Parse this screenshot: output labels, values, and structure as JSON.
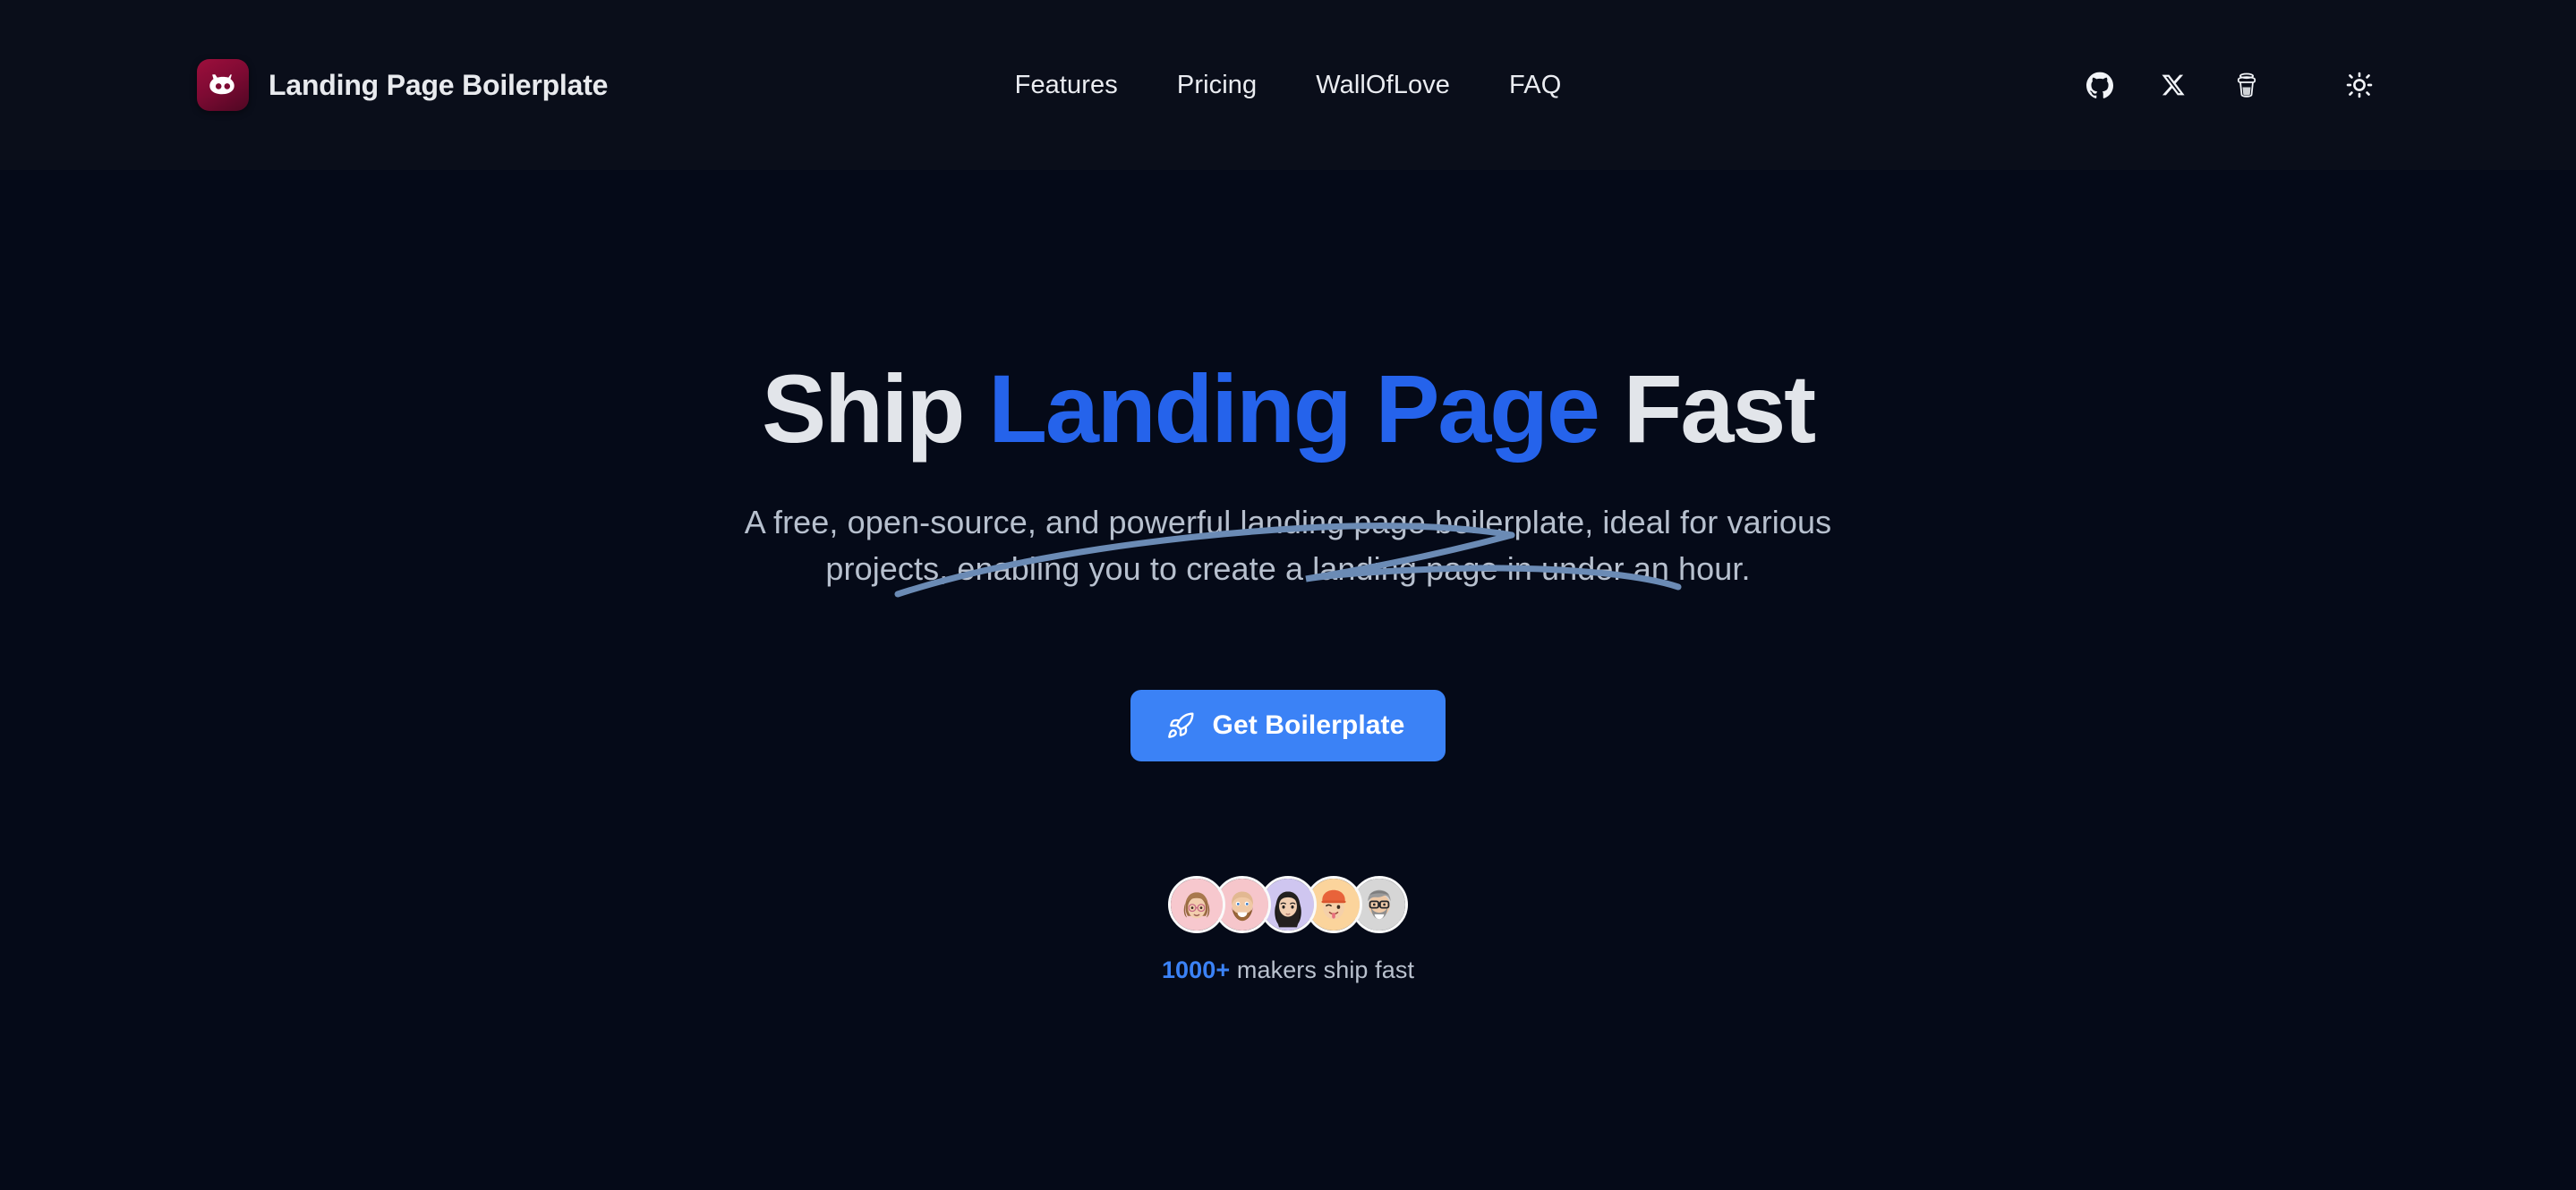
{
  "theme": {
    "background": "#050A18",
    "header_background": "#0A0E1A",
    "accent_blue": "#2563EB",
    "cta_blue": "#3B82F6",
    "heading_text": "#E2E5EA",
    "body_text": "#B7C0CE",
    "logo_gradient_from": "#9D0F3C",
    "logo_gradient_to": "#4E0723",
    "underline_stroke": "#6B8BB5"
  },
  "header": {
    "brand": {
      "name": "Landing Page Boilerplate",
      "logo_icon": "octocat-logo-icon"
    },
    "nav": [
      {
        "label": "Features",
        "name": "nav-link-features"
      },
      {
        "label": "Pricing",
        "name": "nav-link-pricing"
      },
      {
        "label": "WallOfLove",
        "name": "nav-link-wallofove"
      },
      {
        "label": "FAQ",
        "name": "nav-link-faq"
      }
    ],
    "actions": [
      {
        "icon": "github-icon",
        "label": "GitHub"
      },
      {
        "icon": "x-twitter-icon",
        "label": "X"
      },
      {
        "icon": "coffee-cup-icon",
        "label": "Buy me a coffee"
      },
      {
        "icon": "sun-icon",
        "label": "Toggle theme"
      }
    ]
  },
  "hero": {
    "title_part_1": "Ship ",
    "title_accent": "Landing Page",
    "title_part_2": " Fast",
    "title_full": "Ship Landing Page Fast",
    "subtitle": "A free, open-source, and powerful landing page boilerplate, ideal for various projects, enabling you to create a landing page in under an hour.",
    "cta": {
      "label": "Get Boilerplate",
      "icon": "rocket-icon"
    },
    "social_proof": {
      "count": "1000+",
      "caption": " makers ship fast",
      "avatars": [
        {
          "name": "avatar-1",
          "background": "#F7C8CE",
          "description": "woman with glasses and brown hair"
        },
        {
          "name": "avatar-2",
          "background": "#F6C6CB",
          "description": "bald man with brown beard"
        },
        {
          "name": "avatar-3",
          "background": "#CFC6F0",
          "description": "woman with long black hair"
        },
        {
          "name": "avatar-4",
          "background": "#FBD49C",
          "description": "person with orange beanie winking"
        },
        {
          "name": "avatar-5",
          "background": "#D6D6D6",
          "description": "man with gray hair glasses and beard"
        }
      ]
    }
  }
}
